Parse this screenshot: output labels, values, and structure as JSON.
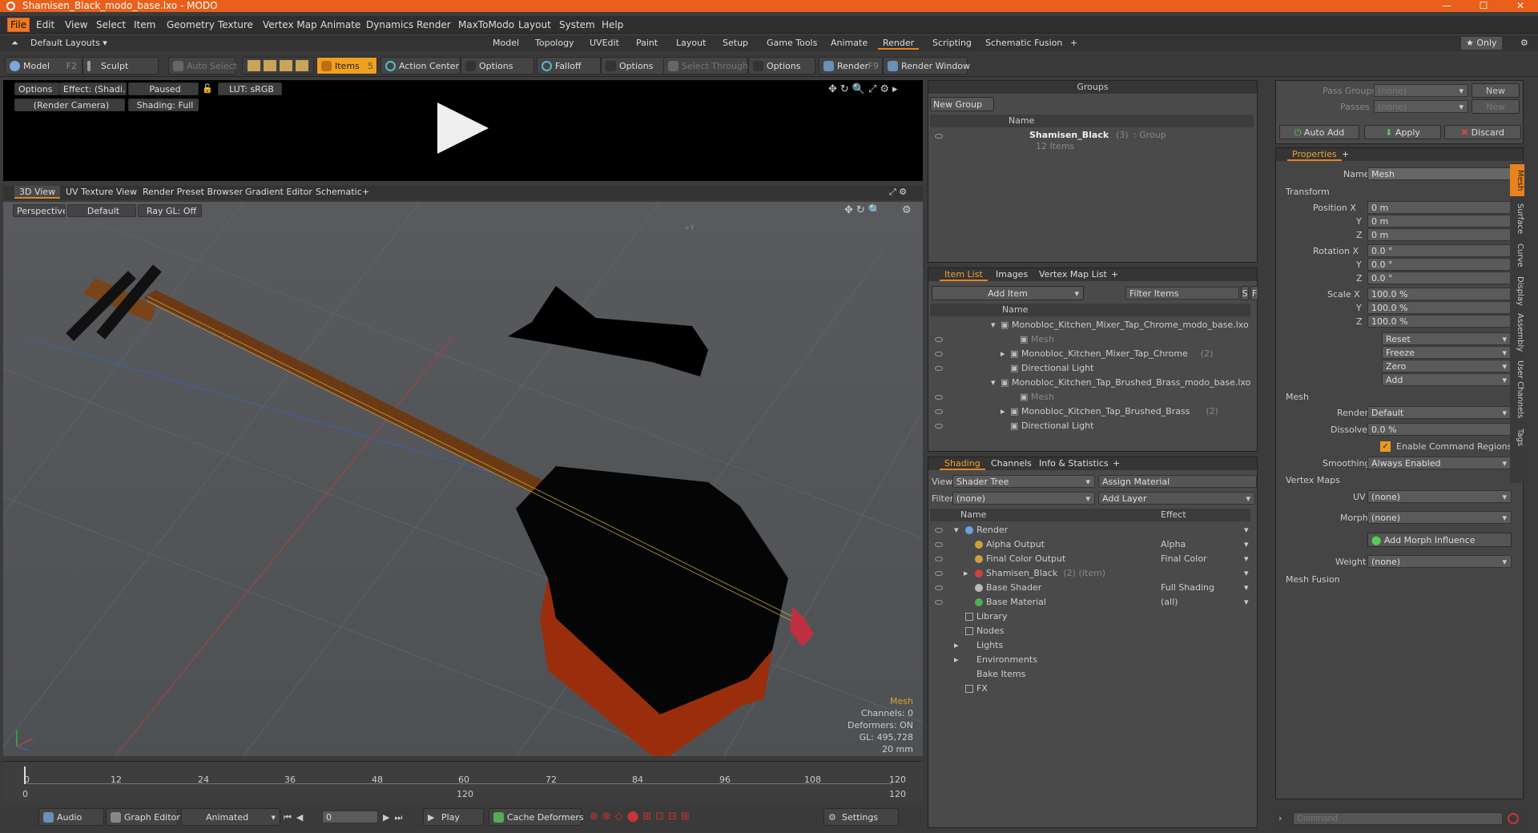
{
  "window": {
    "title": "Shamisen_Black_modo_base.lxo - MODO",
    "min": "—",
    "max": "☐",
    "close": "✕"
  },
  "menu": [
    "File",
    "Edit",
    "View",
    "Select",
    "Item",
    "Geometry",
    "Texture",
    "Vertex Map",
    "Animate",
    "Dynamics",
    "Render",
    "MaxToModo",
    "Layout",
    "System",
    "Help"
  ],
  "layout": {
    "name": "Default Layouts ▾",
    "tabs": [
      "Model",
      "Topology",
      "UVEdit",
      "Paint",
      "Layout",
      "Setup",
      "Game Tools",
      "Animate",
      "Render",
      "Scripting",
      "Schematic Fusion",
      "+"
    ],
    "only": "★ Only"
  },
  "toolbar": {
    "model": "Model",
    "model_key": "F2",
    "sculpt": "Sculpt",
    "auto_select": "Auto Select",
    "items": "Items",
    "items_key": "5",
    "action_center": "Action Center",
    "options1": "Options",
    "falloff": "Falloff",
    "options2": "Options",
    "select_through": "Select Through",
    "options3": "Options",
    "render": "Render",
    "render_key": "F9",
    "render_window": "Render Window"
  },
  "preview": {
    "options": "Options",
    "effect": "Effect: (Shadi...",
    "paused": "Paused",
    "lut": "LUT: sRGB",
    "camera": "(Render Camera)",
    "shading": "Shading: Full"
  },
  "viewtabs": [
    "3D View",
    "UV Texture View",
    "Render Preset Browser",
    "Gradient Editor",
    "Schematic",
    "+"
  ],
  "viewport": {
    "perspective": "Perspective",
    "default": "Default",
    "raygl": "Ray GL: Off",
    "axis_label": "+Y",
    "info_title": "Mesh",
    "info": [
      "Channels: 0",
      "Deformers: ON",
      "GL: 495,728",
      "20 mm"
    ]
  },
  "timeline": {
    "ticks": [
      "0",
      "12",
      "24",
      "36",
      "48",
      "60",
      "72",
      "84",
      "96",
      "108",
      "120"
    ],
    "range_start": "0",
    "range_mid": "120",
    "range_end": "120"
  },
  "bottombar": {
    "audio": "Audio",
    "graph_editor": "Graph Editor",
    "animated": "Animated",
    "frame": "0",
    "play": "Play",
    "cache": "Cache Deformers",
    "settings": "Settings"
  },
  "groups": {
    "title": "Groups",
    "new_group": "New Group",
    "col_name": "Name",
    "item_name": "Shamisen_Black",
    "item_count": "(3)",
    "item_type": ": Group",
    "item_sub": "12 Items"
  },
  "itemlist": {
    "tabs": [
      "Item List",
      "Images",
      "Vertex Map List",
      "+"
    ],
    "add_item": "Add Item",
    "filter": "Filter Items",
    "s": "S",
    "f": "F",
    "col_name": "Name",
    "rows": [
      {
        "text": "Monobloc_Kitchen_Mixer_Tap_Chrome_modo_base.lxo",
        "indent": 0,
        "tri": "▾"
      },
      {
        "text": "Mesh",
        "indent": 2,
        "gray": true
      },
      {
        "text": "Monobloc_Kitchen_Mixer_Tap_Chrome",
        "extra": "(2)",
        "indent": 1,
        "tri": "▸"
      },
      {
        "text": "Directional Light",
        "indent": 1
      },
      {
        "text": "Monobloc_Kitchen_Tap_Brushed_Brass_modo_base.lxo",
        "indent": 0,
        "tri": "▾"
      },
      {
        "text": "Mesh",
        "indent": 2,
        "gray": true
      },
      {
        "text": "Monobloc_Kitchen_Tap_Brushed_Brass",
        "extra": "(2)",
        "indent": 1,
        "tri": "▸"
      },
      {
        "text": "Directional Light",
        "indent": 1
      }
    ]
  },
  "shading": {
    "tabs": [
      "Shading",
      "Channels",
      "Info & Statistics",
      "+"
    ],
    "view_label": "View",
    "view": "Shader Tree",
    "assign": "Assign Material",
    "filter_label": "Filter",
    "filter": "(none)",
    "add_layer": "Add Layer",
    "col_name": "Name",
    "col_effect": "Effect",
    "rows": [
      {
        "name": "Render",
        "effect": "",
        "indent": 0,
        "tri": "▾",
        "color": "#6aa0e0"
      },
      {
        "name": "Alpha Output",
        "effect": "Alpha",
        "indent": 1,
        "color": "#d0a040"
      },
      {
        "name": "Final Color Output",
        "effect": "Final Color",
        "indent": 1,
        "color": "#d0a040"
      },
      {
        "name": "Shamisen_Black",
        "extra": "(2) (Item)",
        "effect": "",
        "indent": 1,
        "tri": "▸",
        "color": "#d04040"
      },
      {
        "name": "Base Shader",
        "effect": "Full Shading",
        "indent": 1,
        "color": "#bbbbbb"
      },
      {
        "name": "Base Material",
        "effect": "(all)",
        "indent": 1,
        "color": "#50b050"
      },
      {
        "name": "Library",
        "effect": "",
        "indent": 0,
        "folder": true
      },
      {
        "name": "Nodes",
        "effect": "",
        "indent": 0,
        "folder": true
      },
      {
        "name": "Lights",
        "effect": "",
        "indent": 0,
        "tri": "▸"
      },
      {
        "name": "Environments",
        "effect": "",
        "indent": 0,
        "tri": "▸"
      },
      {
        "name": "Bake Items",
        "effect": "",
        "indent": 0
      },
      {
        "name": "FX",
        "effect": "",
        "indent": 0,
        "folder": true
      }
    ]
  },
  "passes": {
    "pass_groups": "Pass Groups",
    "passes": "Passes",
    "none": "(none)",
    "new": "New",
    "auto_add": "Auto Add",
    "apply": "Apply",
    "discard": "Discard"
  },
  "properties": {
    "tab": "Properties",
    "plus": "+",
    "name_label": "Name",
    "name": "Mesh",
    "transform": "Transform",
    "position_label": "Position X",
    "rotation_label": "Rotation X",
    "scale_label": "Scale X",
    "y": "Y",
    "z": "Z",
    "position": [
      "0 m",
      "0 m",
      "0 m"
    ],
    "rotation": [
      "0.0 °",
      "0.0 °",
      "0.0 °"
    ],
    "scale": [
      "100.0 %",
      "100.0 %",
      "100.0 %"
    ],
    "reset": "Reset",
    "freeze": "Freeze",
    "zero": "Zero",
    "add": "Add",
    "mesh": "Mesh",
    "render_label": "Render",
    "render": "Default",
    "dissolve_label": "Dissolve",
    "dissolve": "0.0 %",
    "enable_cmd": "Enable Command Regions",
    "smoothing_label": "Smoothing",
    "smoothing": "Always Enabled",
    "vertex_maps": "Vertex Maps",
    "uv_label": "UV",
    "uv": "(none)",
    "morph_label": "Morph",
    "morph": "(none)",
    "add_morph": "Add Morph Influence",
    "weight_label": "Weight",
    "weight": "(none)",
    "mesh_fusion": "Mesh Fusion",
    "sidetabs": [
      "Mesh",
      "Surface",
      "Curve",
      "Display",
      "Assembly",
      "User Channels",
      "Tags"
    ]
  },
  "command": {
    "placeholder": "Command"
  }
}
